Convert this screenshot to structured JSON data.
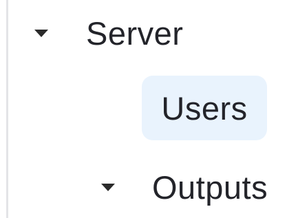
{
  "tree": {
    "items": [
      {
        "label": "Server",
        "expanded": true,
        "caret_icon": "caret-down-icon"
      },
      {
        "label": "Users",
        "selected": true,
        "highlight_color": "#e9f3fd"
      },
      {
        "label": "Outputs",
        "expanded": true,
        "caret_icon": "caret-down-icon"
      }
    ]
  }
}
